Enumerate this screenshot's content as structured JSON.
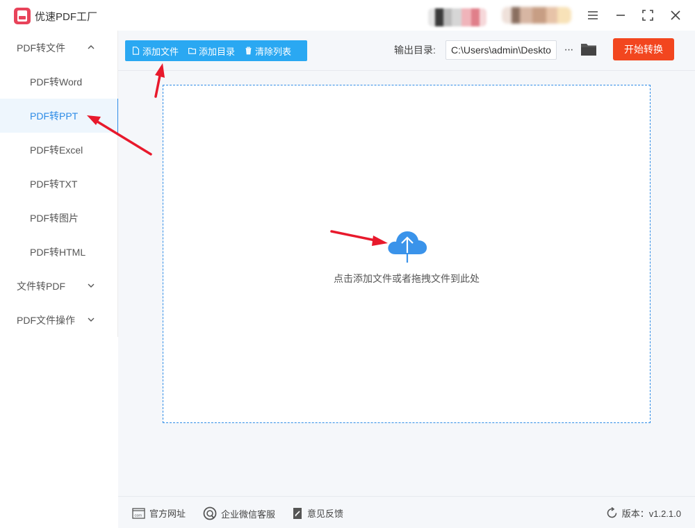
{
  "app": {
    "title": "优速PDF工厂"
  },
  "sidebar": {
    "groups": [
      {
        "label": "PDF转文件",
        "expanded": true,
        "items": [
          {
            "label": "PDF转Word"
          },
          {
            "label": "PDF转PPT",
            "active": true
          },
          {
            "label": "PDF转Excel"
          },
          {
            "label": "PDF转TXT"
          },
          {
            "label": "PDF转图片"
          },
          {
            "label": "PDF转HTML"
          }
        ]
      },
      {
        "label": "文件转PDF",
        "expanded": false
      },
      {
        "label": "PDF文件操作",
        "expanded": false
      }
    ]
  },
  "toolbar": {
    "add_file": "添加文件",
    "add_folder": "添加目录",
    "clear_list": "清除列表",
    "output_label": "输出目录:",
    "output_path": "C:\\Users\\admin\\Deskto",
    "more": "···",
    "start": "开始转换"
  },
  "dropzone": {
    "hint": "点击添加文件或者拖拽文件到此处"
  },
  "footer": {
    "website": "官方网址",
    "wechat": "企业微信客服",
    "feedback": "意见反馈",
    "version": "版本：v1.2.1.0"
  },
  "colors": {
    "accent": "#2c8be6",
    "toolbar_button": "#2aa8f2",
    "start_button": "#f2461f",
    "annotation": "#e8192c"
  },
  "icons": [
    "app-logo-icon",
    "menu-icon",
    "minimize-icon",
    "maximize-icon",
    "close-icon",
    "file-icon",
    "folder-icon",
    "trash-icon",
    "upload-cloud-icon",
    "website-icon",
    "wechat-service-icon",
    "feedback-icon",
    "refresh-icon"
  ]
}
